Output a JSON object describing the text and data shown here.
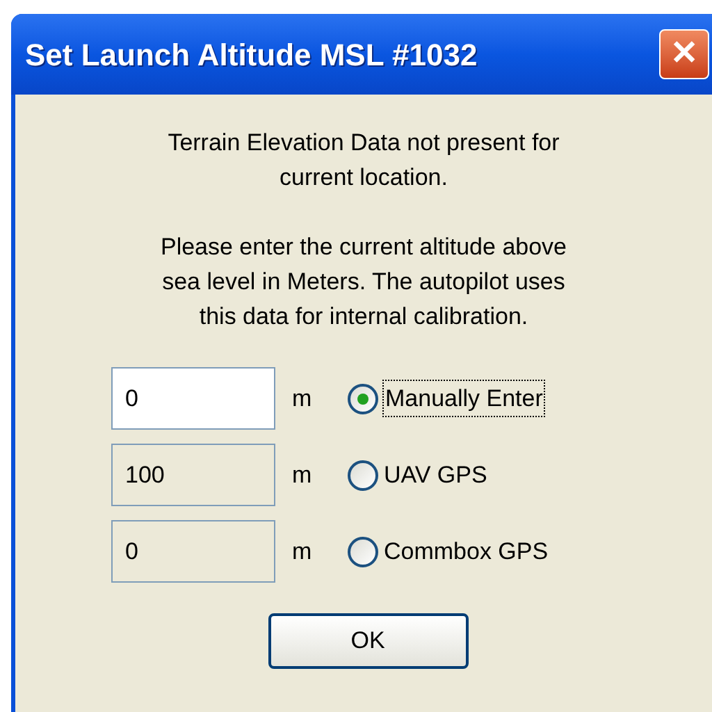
{
  "window": {
    "title": "Set Launch Altitude MSL #1032",
    "close": "✕"
  },
  "messages": [
    "Terrain Elevation Data not present for current location.",
    "Please enter the current altitude above sea level in Meters. The autopilot uses this data for internal calibration."
  ],
  "rows": [
    {
      "value": "0",
      "unit": "m",
      "disabled": false,
      "option": "Manually Enter",
      "selected": true
    },
    {
      "value": "100",
      "unit": "m",
      "disabled": true,
      "option": "UAV GPS",
      "selected": false
    },
    {
      "value": "0",
      "unit": "m",
      "disabled": true,
      "option": "Commbox GPS",
      "selected": false
    }
  ],
  "buttons": [
    "OK"
  ]
}
